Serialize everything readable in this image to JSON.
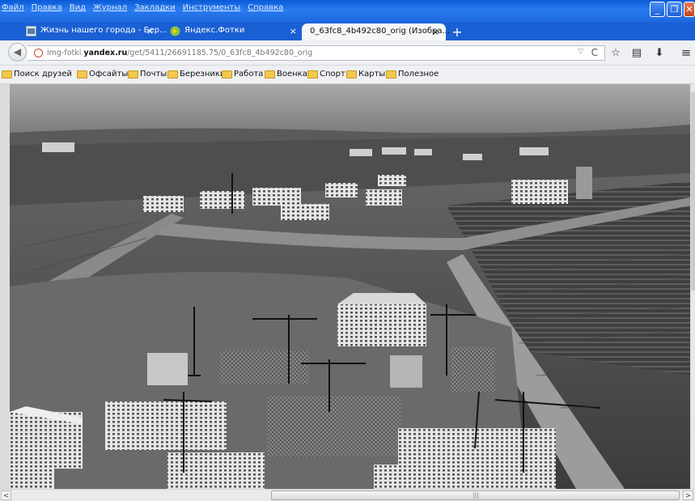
{
  "menu": [
    "Файл",
    "Правка",
    "Вид",
    "Журнал",
    "Закладки",
    "Инструменты",
    "Справка"
  ],
  "window_buttons": {
    "minimize": "_",
    "restore": "❐",
    "close": "✕"
  },
  "tabs": [
    {
      "title": "Жизнь нашего города - Бер...",
      "close": "×"
    },
    {
      "title": "Яндекс.Фотки",
      "close": "×"
    },
    {
      "title": "0_63fc8_4b492c80_orig (Изобра...",
      "close": "×"
    }
  ],
  "new_tab": "+",
  "nav": {
    "back": "◀",
    "dropdown": "▽",
    "reload": "C"
  },
  "url": {
    "prefix": "img-fotki.",
    "host": "yandex.ru",
    "path": "/get/5411/26691185.75/0_63fc8_4b492c80_orig"
  },
  "toolbar": {
    "bookmark_star": "☆",
    "reading_list": "▤",
    "downloads": "⬇",
    "menu": "≡"
  },
  "bookmarks": [
    "Поиск друзей",
    "Офсайты",
    "Почты",
    "Березники",
    "Работа",
    "Военка",
    "Спорт",
    "Карты",
    "Полезное"
  ],
  "scrollbar": {
    "left": "<",
    "right": ">",
    "grip": "|||"
  },
  "colors": {
    "titlebar": "#1a64dc",
    "folder": "#f3c94b"
  }
}
